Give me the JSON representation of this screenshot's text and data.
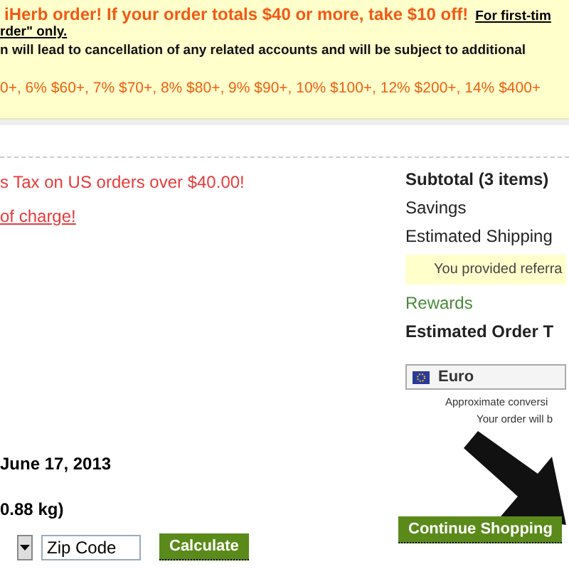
{
  "promo_banner": {
    "headline": "iHerb order! If your order totals $40 or more, take $10 off!",
    "headline_link": "For first-tim",
    "link_continuation": "rder\" only.",
    "warning": "n will lead to cancellation of any related accounts and will be subject to additional",
    "discount_tiers": "0+, 6% $60+, 7% $70+, 8% $80+, 9% $90+, 10% $100+, 12% $200+, 14% $400+"
  },
  "left_column": {
    "tax_notice": "s Tax on US orders over $40.00!",
    "free_link": "of charge!",
    "date": "June 17, 2013",
    "weight": "0.88 kg)",
    "zip_placeholder": "Zip Code",
    "calculate_button": "Calculate"
  },
  "summary": {
    "subtotal": "Subtotal (3 items)",
    "savings": "Savings",
    "shipping": "Estimated Shipping",
    "referral_note": "You provided referra",
    "rewards": "Rewards",
    "order_total": "Estimated Order T",
    "currency": "Euro",
    "conversion_note": "Approximate conversi",
    "order_note": "Your order will b",
    "continue_button": "Continue Shopping"
  }
}
